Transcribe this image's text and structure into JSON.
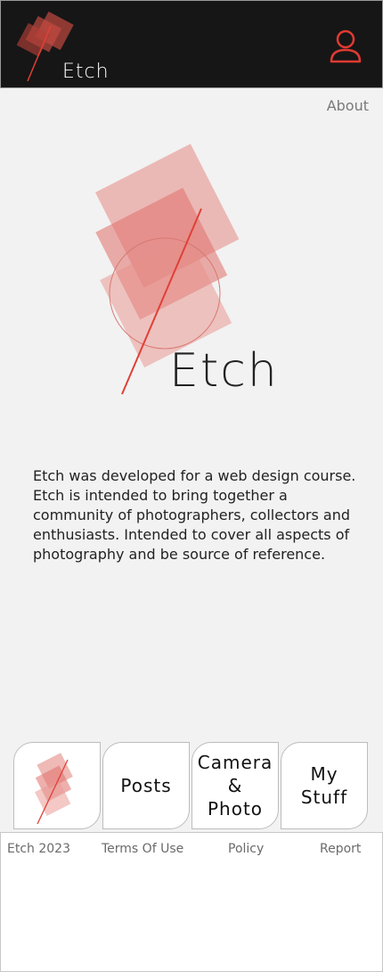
{
  "header": {
    "title": "Etch",
    "logo_icon": "etch-logo-icon",
    "user_icon": "user-profile-icon",
    "accent_color": "#e03a32"
  },
  "nav_top": {
    "about_label": "About"
  },
  "hero": {
    "title": "Etch"
  },
  "intro": {
    "text": "Etch was developed for a web design course. Etch is intended to bring together a community of photographers, collectors and enthusiasts. Intended to cover all aspects of photography and be source of reference."
  },
  "bottom_nav": {
    "items": [
      {
        "label": "",
        "icon": "etch-logo-icon"
      },
      {
        "label": "Posts"
      },
      {
        "label": "Camera & Photo"
      },
      {
        "label": "My Stuff"
      }
    ]
  },
  "footer": {
    "copyright": "Etch 2023",
    "terms": "Terms Of Use",
    "policy": "Policy",
    "report": "Report"
  }
}
